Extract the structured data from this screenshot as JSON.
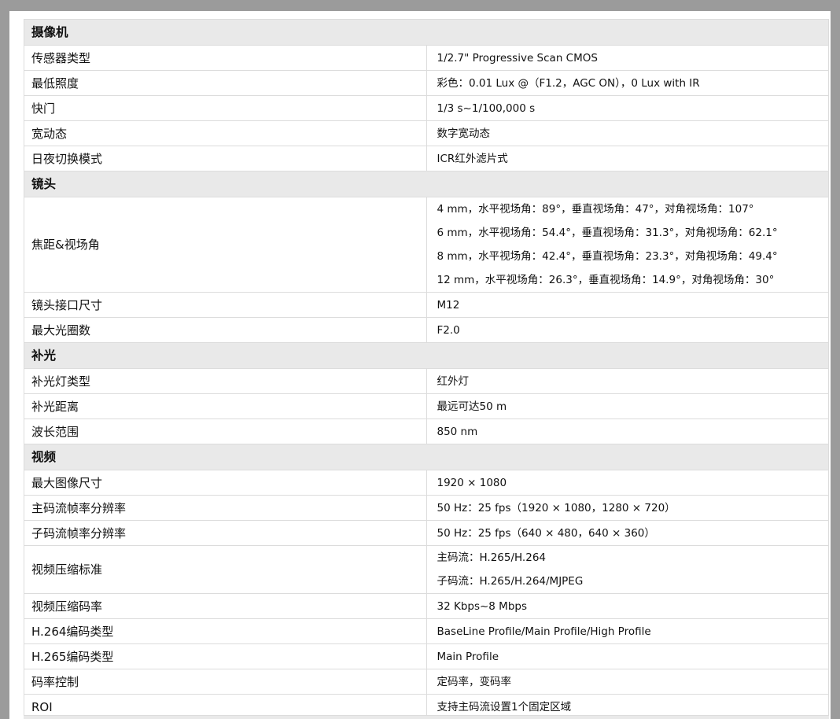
{
  "sections": {
    "camera": {
      "title": "摄像机",
      "rows": [
        {
          "key": "传感器类型",
          "value": "1/2.7\" Progressive Scan CMOS"
        },
        {
          "key": "最低照度",
          "value": "彩色：0.01 Lux @（F1.2，AGC ON），0 Lux with IR"
        },
        {
          "key": "快门",
          "value": "1/3 s~1/100,000 s"
        },
        {
          "key": "宽动态",
          "value": "数字宽动态"
        },
        {
          "key": "日夜切换模式",
          "value": "ICR红外滤片式"
        }
      ]
    },
    "lens": {
      "title": "镜头",
      "focal": {
        "key": "焦距&视场角",
        "lines": [
          "4 mm，水平视场角：89°，垂直视场角：47°，对角视场角：107°",
          "6 mm，水平视场角：54.4°，垂直视场角：31.3°，对角视场角：62.1°",
          "8 mm，水平视场角：42.4°，垂直视场角：23.3°，对角视场角：49.4°",
          "12 mm，水平视场角：26.3°，垂直视场角：14.9°，对角视场角：30°"
        ]
      },
      "rows": [
        {
          "key": "镜头接口尺寸",
          "value": "M12"
        },
        {
          "key": "最大光圈数",
          "value": "F2.0"
        }
      ]
    },
    "light": {
      "title": "补光",
      "rows": [
        {
          "key": "补光灯类型",
          "value": "红外灯"
        },
        {
          "key": "补光距离",
          "value": "最远可达50 m"
        },
        {
          "key": "波长范围",
          "value": "850 nm"
        }
      ]
    },
    "video": {
      "title": "视频",
      "rows_a": [
        {
          "key": "最大图像尺寸",
          "value": "1920 × 1080"
        },
        {
          "key": "主码流帧率分辨率",
          "value": "50 Hz：25 fps（1920 × 1080，1280 × 720）"
        },
        {
          "key": "子码流帧率分辨率",
          "value": "50 Hz：25 fps（640 × 480，640 × 360）"
        }
      ],
      "compression": {
        "key": "视频压缩标准",
        "lines": [
          "主码流：H.265/H.264",
          "子码流：H.265/H.264/MJPEG"
        ]
      },
      "rows_b": [
        {
          "key": "视频压缩码率",
          "value": "32 Kbps~8 Mbps"
        },
        {
          "key": "H.264编码类型",
          "value": "BaseLine Profile/Main Profile/High Profile"
        },
        {
          "key": "H.265编码类型",
          "value": "Main Profile"
        },
        {
          "key": "码率控制",
          "value": "定码率，变码率"
        },
        {
          "key": "ROI",
          "value": "支持主码流设置1个固定区域"
        }
      ]
    }
  }
}
